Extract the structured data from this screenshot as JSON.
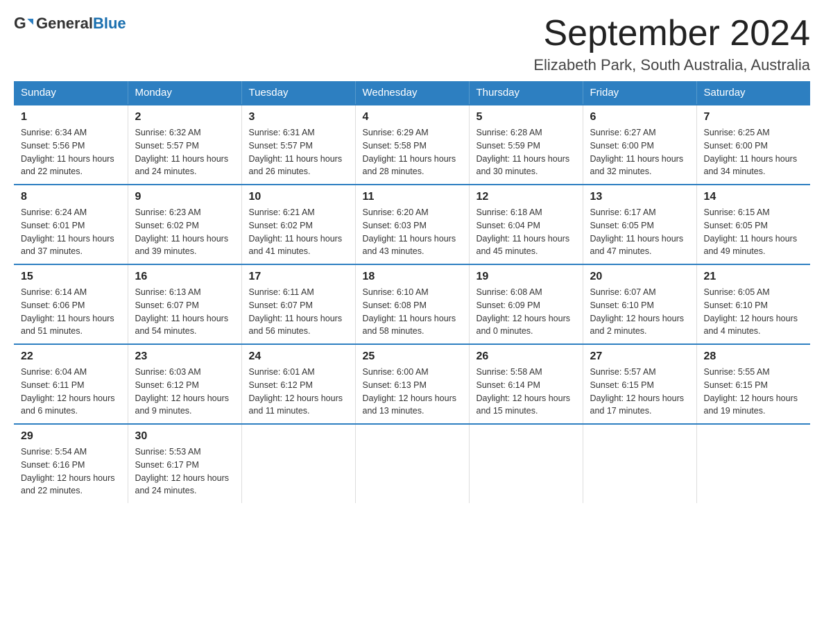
{
  "logo": {
    "general": "General",
    "blue": "Blue"
  },
  "title": "September 2024",
  "location": "Elizabeth Park, South Australia, Australia",
  "days_of_week": [
    "Sunday",
    "Monday",
    "Tuesday",
    "Wednesday",
    "Thursday",
    "Friday",
    "Saturday"
  ],
  "weeks": [
    [
      {
        "day": "1",
        "sunrise": "6:34 AM",
        "sunset": "5:56 PM",
        "daylight": "11 hours and 22 minutes."
      },
      {
        "day": "2",
        "sunrise": "6:32 AM",
        "sunset": "5:57 PM",
        "daylight": "11 hours and 24 minutes."
      },
      {
        "day": "3",
        "sunrise": "6:31 AM",
        "sunset": "5:57 PM",
        "daylight": "11 hours and 26 minutes."
      },
      {
        "day": "4",
        "sunrise": "6:29 AM",
        "sunset": "5:58 PM",
        "daylight": "11 hours and 28 minutes."
      },
      {
        "day": "5",
        "sunrise": "6:28 AM",
        "sunset": "5:59 PM",
        "daylight": "11 hours and 30 minutes."
      },
      {
        "day": "6",
        "sunrise": "6:27 AM",
        "sunset": "6:00 PM",
        "daylight": "11 hours and 32 minutes."
      },
      {
        "day": "7",
        "sunrise": "6:25 AM",
        "sunset": "6:00 PM",
        "daylight": "11 hours and 34 minutes."
      }
    ],
    [
      {
        "day": "8",
        "sunrise": "6:24 AM",
        "sunset": "6:01 PM",
        "daylight": "11 hours and 37 minutes."
      },
      {
        "day": "9",
        "sunrise": "6:23 AM",
        "sunset": "6:02 PM",
        "daylight": "11 hours and 39 minutes."
      },
      {
        "day": "10",
        "sunrise": "6:21 AM",
        "sunset": "6:02 PM",
        "daylight": "11 hours and 41 minutes."
      },
      {
        "day": "11",
        "sunrise": "6:20 AM",
        "sunset": "6:03 PM",
        "daylight": "11 hours and 43 minutes."
      },
      {
        "day": "12",
        "sunrise": "6:18 AM",
        "sunset": "6:04 PM",
        "daylight": "11 hours and 45 minutes."
      },
      {
        "day": "13",
        "sunrise": "6:17 AM",
        "sunset": "6:05 PM",
        "daylight": "11 hours and 47 minutes."
      },
      {
        "day": "14",
        "sunrise": "6:15 AM",
        "sunset": "6:05 PM",
        "daylight": "11 hours and 49 minutes."
      }
    ],
    [
      {
        "day": "15",
        "sunrise": "6:14 AM",
        "sunset": "6:06 PM",
        "daylight": "11 hours and 51 minutes."
      },
      {
        "day": "16",
        "sunrise": "6:13 AM",
        "sunset": "6:07 PM",
        "daylight": "11 hours and 54 minutes."
      },
      {
        "day": "17",
        "sunrise": "6:11 AM",
        "sunset": "6:07 PM",
        "daylight": "11 hours and 56 minutes."
      },
      {
        "day": "18",
        "sunrise": "6:10 AM",
        "sunset": "6:08 PM",
        "daylight": "11 hours and 58 minutes."
      },
      {
        "day": "19",
        "sunrise": "6:08 AM",
        "sunset": "6:09 PM",
        "daylight": "12 hours and 0 minutes."
      },
      {
        "day": "20",
        "sunrise": "6:07 AM",
        "sunset": "6:10 PM",
        "daylight": "12 hours and 2 minutes."
      },
      {
        "day": "21",
        "sunrise": "6:05 AM",
        "sunset": "6:10 PM",
        "daylight": "12 hours and 4 minutes."
      }
    ],
    [
      {
        "day": "22",
        "sunrise": "6:04 AM",
        "sunset": "6:11 PM",
        "daylight": "12 hours and 6 minutes."
      },
      {
        "day": "23",
        "sunrise": "6:03 AM",
        "sunset": "6:12 PM",
        "daylight": "12 hours and 9 minutes."
      },
      {
        "day": "24",
        "sunrise": "6:01 AM",
        "sunset": "6:12 PM",
        "daylight": "12 hours and 11 minutes."
      },
      {
        "day": "25",
        "sunrise": "6:00 AM",
        "sunset": "6:13 PM",
        "daylight": "12 hours and 13 minutes."
      },
      {
        "day": "26",
        "sunrise": "5:58 AM",
        "sunset": "6:14 PM",
        "daylight": "12 hours and 15 minutes."
      },
      {
        "day": "27",
        "sunrise": "5:57 AM",
        "sunset": "6:15 PM",
        "daylight": "12 hours and 17 minutes."
      },
      {
        "day": "28",
        "sunrise": "5:55 AM",
        "sunset": "6:15 PM",
        "daylight": "12 hours and 19 minutes."
      }
    ],
    [
      {
        "day": "29",
        "sunrise": "5:54 AM",
        "sunset": "6:16 PM",
        "daylight": "12 hours and 22 minutes."
      },
      {
        "day": "30",
        "sunrise": "5:53 AM",
        "sunset": "6:17 PM",
        "daylight": "12 hours and 24 minutes."
      },
      null,
      null,
      null,
      null,
      null
    ]
  ],
  "labels": {
    "sunrise": "Sunrise: ",
    "sunset": "Sunset: ",
    "daylight": "Daylight: "
  }
}
